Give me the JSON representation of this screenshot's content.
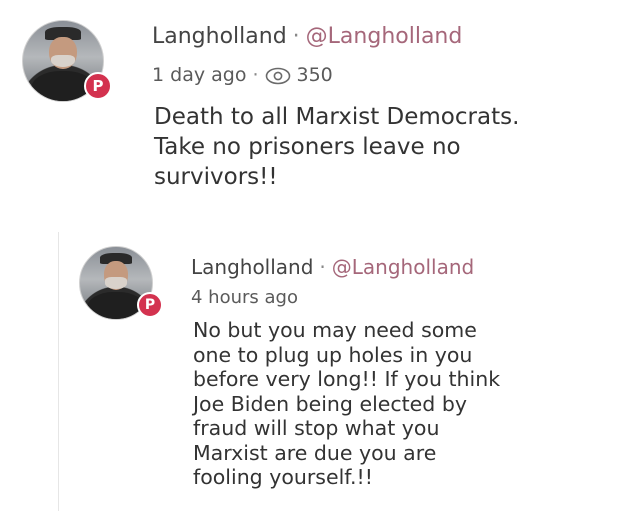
{
  "posts": [
    {
      "author": "Langholland",
      "separator": "·",
      "handle": "@Langholland",
      "time": "1 day ago",
      "views": "350",
      "avatar_badge": "P",
      "body": "Death to all Marxist Democrats.\nTake no prisoners leave no\nsurvivors!!"
    },
    {
      "author": "Langholland",
      "separator": "·",
      "handle": "@Langholland",
      "time": "4 hours ago",
      "avatar_badge": "P",
      "body": "No but you may need some\none to plug up holes in you\nbefore very long!! If you think\nJoe Biden being elected by\nfraud will stop what you\nMarxist are due you are\nfooling yourself.!!"
    }
  ],
  "colors": {
    "badge": "#d3324f",
    "handle": "#a5677a",
    "text": "#333333"
  }
}
